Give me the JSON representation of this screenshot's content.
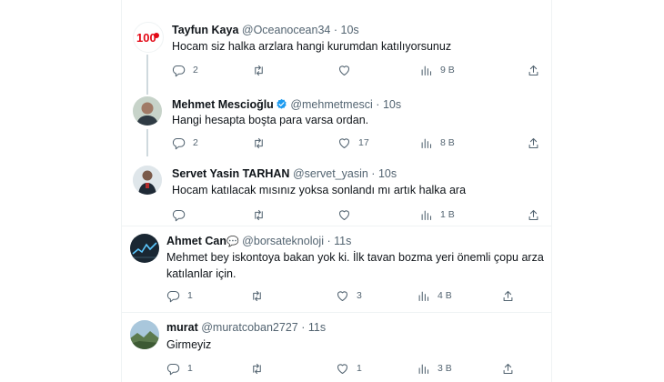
{
  "tweets": [
    {
      "name": "Tayfun Kaya",
      "handle": "@Oceanocean34",
      "time": "10s",
      "text": "Hocam siz halka arzlara hangi kurumdan katılıyorsunuz",
      "avatar_text": "100",
      "stats": {
        "replies": "2",
        "retweets": "",
        "likes": "",
        "views": "9 B"
      }
    },
    {
      "name": "Mehmet Mescioğlu",
      "handle": "@mehmetmesci",
      "time": "10s",
      "text": "Hangi hesapta boşta para varsa ordan.",
      "verified_color": "#1d9bf0",
      "stats": {
        "replies": "2",
        "retweets": "",
        "likes": "17",
        "views": "8 B"
      }
    },
    {
      "name": "Servet Yasin TARHAN",
      "handle": "@servet_yasin",
      "time": "10s",
      "text": "Hocam katılacak mısınız yoksa sonlandı mı artık halka ara",
      "stats": {
        "replies": "",
        "retweets": "",
        "likes": "",
        "views": "1 B"
      }
    },
    {
      "name": "Ahmet Can",
      "name_emoji": "💬",
      "handle": "@borsateknoloji",
      "time": "11s",
      "text_line1": "Mehmet bey iskontoya bakan yok ki. İlk tavan bozma yeri önemli çopu arza",
      "text_line2": "katılanlar için.",
      "stats": {
        "replies": "1",
        "retweets": "",
        "likes": "3",
        "views": "4 B"
      }
    },
    {
      "name": "murat",
      "handle": "@muratcoban2727",
      "time": "11s",
      "text": "Girmeyiz",
      "stats": {
        "replies": "1",
        "retweets": "",
        "likes": "1",
        "views": "3 B"
      }
    }
  ],
  "separator": "·",
  "colors": {
    "text": "#0f1419",
    "muted": "#536471",
    "border": "#eff3f4",
    "verified": "#1d9bf0",
    "logo_red": "#e30a17"
  },
  "icons": [
    "reply-icon",
    "retweet-icon",
    "like-icon",
    "views-icon",
    "share-icon"
  ]
}
